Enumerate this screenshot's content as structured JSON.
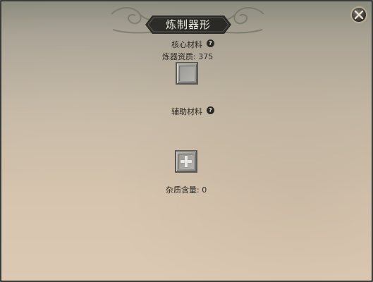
{
  "window": {
    "title": "炼制器形",
    "close_icon": "close-x-icon"
  },
  "core_material": {
    "label": "核心材料",
    "help_glyph": "?",
    "quality_text": "炼器资质: 375"
  },
  "aux_material": {
    "label": "辅助材料",
    "help_glyph": "?",
    "slot_icon": "plus-icon"
  },
  "impurity": {
    "text": "杂质含量: 0"
  },
  "colors": {
    "title_plate": "#2a2926",
    "title_text": "#f2ede2",
    "parchment_top": "#8a8b7d",
    "parchment_bottom": "#dcc9b3",
    "slot": "#a6a49e",
    "label_text": "#2c2a25"
  }
}
